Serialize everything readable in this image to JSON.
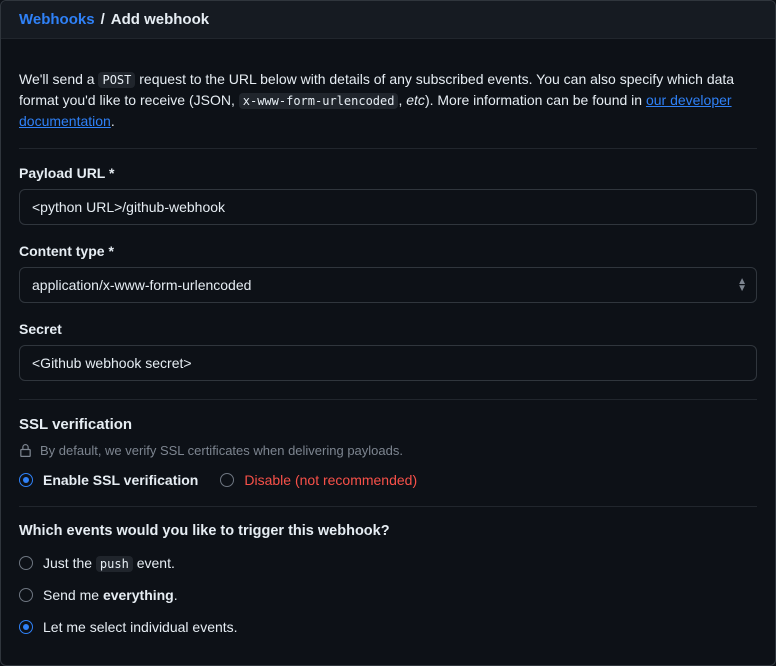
{
  "breadcrumb": {
    "root": "Webhooks",
    "separator": "/",
    "leaf": "Add webhook"
  },
  "intro": {
    "pre": "We'll send a ",
    "method_code": "POST",
    "mid1": " request to the URL below with details of any subscribed events. You can also specify which data format you'd like to receive (JSON, ",
    "ct_code": "x-www-form-urlencoded",
    "mid2": ", ",
    "etc_em": "etc",
    "post": "). More information can be found in ",
    "link_text": "our developer documentation",
    "period": "."
  },
  "payload_url": {
    "label": "Payload URL *",
    "value": "<python URL>/github-webhook"
  },
  "content_type": {
    "label": "Content type *",
    "selected": "application/x-www-form-urlencoded"
  },
  "secret": {
    "label": "Secret",
    "value": "<Github webhook secret>"
  },
  "ssl": {
    "heading": "SSL verification",
    "note": "By default, we verify SSL certificates when delivering payloads.",
    "enable_label": "Enable SSL verification",
    "disable_label": "Disable ",
    "disable_note": "(not recommended)"
  },
  "events": {
    "question": "Which events would you like to trigger this webhook?",
    "opt_push_pre": "Just the ",
    "opt_push_code": "push",
    "opt_push_post": " event.",
    "opt_everything_pre": "Send me ",
    "opt_everything_strong": "everything",
    "opt_everything_post": ".",
    "opt_individual": "Let me select individual events."
  }
}
